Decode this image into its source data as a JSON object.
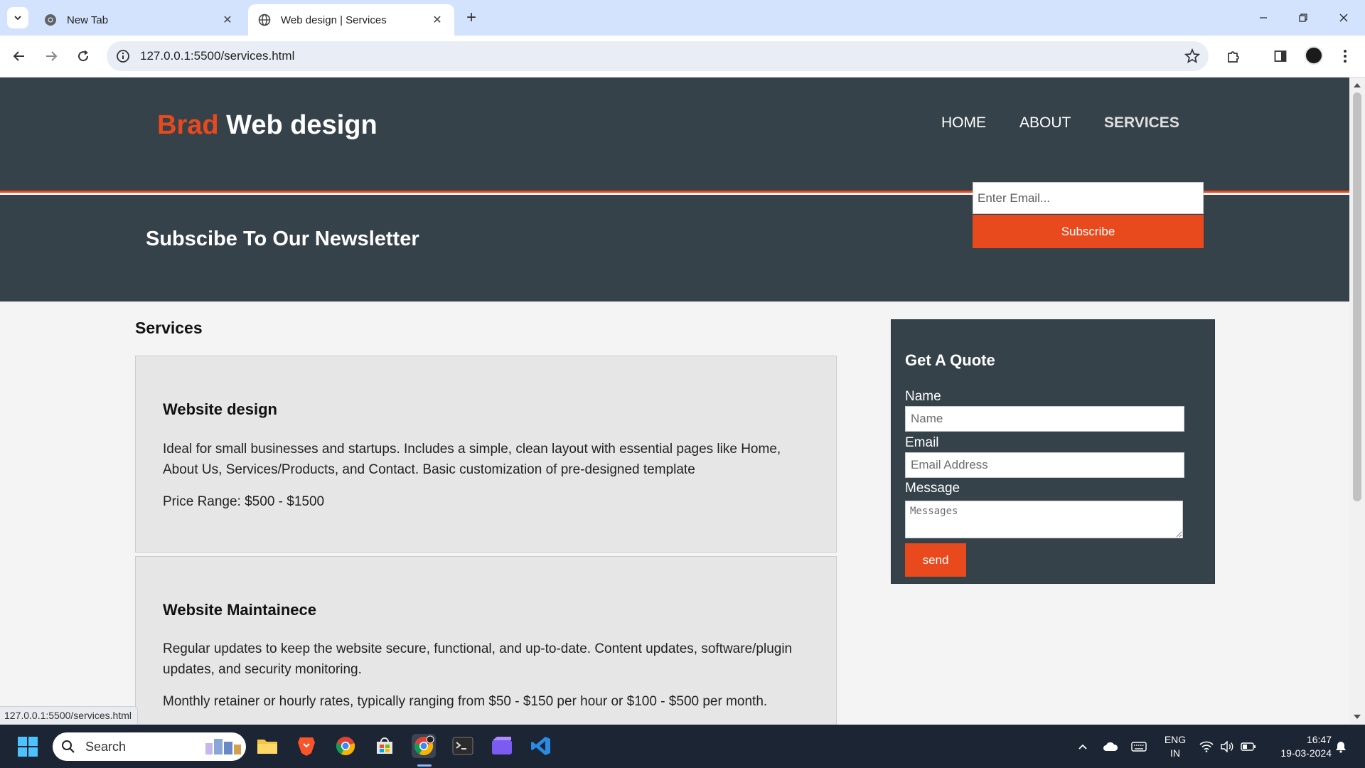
{
  "browser": {
    "tabs": [
      {
        "title": "New Tab",
        "active": false,
        "icon": "chrome-icon"
      },
      {
        "title": "Web design | Services",
        "active": true,
        "icon": "globe-icon"
      }
    ],
    "url": "127.0.0.1:5500/services.html",
    "status_url": "127.0.0.1:5500/services.html"
  },
  "site": {
    "logo_highlight": "Brad",
    "logo_rest": "Web design",
    "nav": [
      "HOME",
      "ABOUT",
      "SERVICES"
    ],
    "current_nav": "SERVICES",
    "accent_color": "#e8491d",
    "dark_color": "#35424a"
  },
  "newsletter": {
    "title": "Subscibe To Our Newsletter",
    "email_placeholder": "Enter Email...",
    "button": "Subscribe"
  },
  "services": {
    "title": "Services",
    "items": [
      {
        "name": "Website design",
        "description": "Ideal for small businesses and startups. Includes a simple, clean layout with essential pages like Home, About Us, Services/Products, and Contact. Basic customization of pre-designed template",
        "price": "Price Range: $500 - $1500"
      },
      {
        "name": "Website Maintainece",
        "description": "Regular updates to keep the website secure, functional, and up-to-date. Content updates, software/plugin updates, and security monitoring.",
        "price": "Monthly retainer or hourly rates, typically ranging from $50 - $150 per hour or $100 - $500 per month."
      }
    ]
  },
  "quote": {
    "title": "Get A Quote",
    "name_label": "Name",
    "name_placeholder": "Name",
    "email_label": "Email",
    "email_placeholder": "Email Address",
    "message_label": "Message",
    "message_placeholder": "Messages",
    "send": "send"
  },
  "taskbar": {
    "search_label": "Search",
    "lang_line1": "ENG",
    "lang_line2": "IN",
    "time": "16:47",
    "date": "19-03-2024"
  }
}
